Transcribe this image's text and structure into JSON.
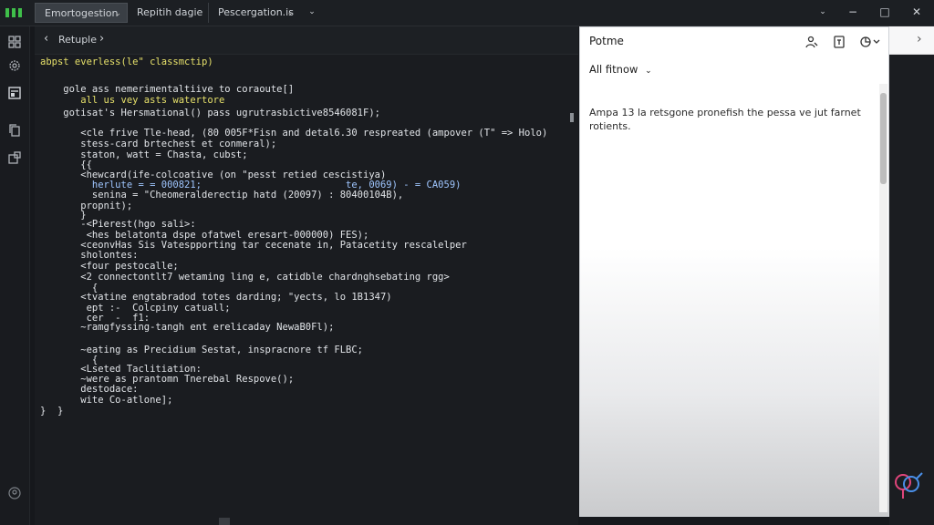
{
  "tabs": [
    {
      "label": "Emortogestion",
      "chevron": "⌄"
    },
    {
      "label": "Repitih dagie"
    },
    {
      "label": "Pescergation.is",
      "chevron": "⌄"
    }
  ],
  "tab_menu_chevron": "⌄",
  "window_controls": {
    "chevron": "⌄",
    "minimize": "−",
    "restore": "□",
    "close": "✕"
  },
  "activity_icons": [
    "files-icon",
    "settings-gear-icon",
    "document-icon",
    "copy-icon",
    "extensions-icon",
    "account-icon"
  ],
  "breadcrumb": {
    "back": "‹",
    "label": "Retuple",
    "forward": "›"
  },
  "code_lines": [
    {
      "text": "abpst everless(le\" classmctip)",
      "cls": "c-yellow"
    },
    {
      "text": "    gole ass nemerimentaltiive to coraoute[]",
      "cls": ""
    },
    {
      "text": "       all us vey asts watertore",
      "cls": "c-yellow"
    },
    {
      "text": "    gotisat's Hersmational() pass ugrutrasbictive8546081F);",
      "cls": ""
    },
    {
      "text": "       <cle frive Tle-head, (80 005F*Fisn and detal6.30 respreated (ampover (T\" => Holo)",
      "cls": ""
    },
    {
      "text": "       stess-card brtechest et conmeral);",
      "cls": ""
    },
    {
      "text": "       staton, watt = Chasta, cubst;",
      "cls": ""
    },
    {
      "text": "       {{",
      "cls": ""
    },
    {
      "text": "       <hewcard(ife-colcoative (on \"pesst retied cescistiya)",
      "cls": ""
    },
    {
      "text": "         herlute = = 000821;                         te, 0069) - = CA059)",
      "cls": "c-blue"
    },
    {
      "text": "         senina = \"Cheomeralderectip hatd (20097) : 80400104B),",
      "cls": ""
    },
    {
      "text": "       propnit);",
      "cls": ""
    },
    {
      "text": "       }",
      "cls": ""
    },
    {
      "text": "       -<Pierest(hgo sali>:",
      "cls": ""
    },
    {
      "text": "        <hes belatonta dspe ofatwel eresart-000000) FES);",
      "cls": ""
    },
    {
      "text": "       <ceonvHas Sis Vatespporting tar cecenate in, Patacetity rescalelper",
      "cls": ""
    },
    {
      "text": "       sholontes:",
      "cls": ""
    },
    {
      "text": "       <four pestocalle;",
      "cls": ""
    },
    {
      "text": "       <2 connectontlt7 wetaming ling e, catidble chardnghsebating rgg>",
      "cls": ""
    },
    {
      "text": "         {",
      "cls": ""
    },
    {
      "text": "       <tvatine engtabradod totes darding; \"yects, lo 1B1347)",
      "cls": ""
    },
    {
      "text": "        ept :-  Colcpiny catuall;",
      "cls": ""
    },
    {
      "text": "        cer  -  f1:",
      "cls": ""
    },
    {
      "text": "       ~ramgfyssing-tangh ent erelicaday NewaB0Fl);",
      "cls": ""
    },
    {
      "text": "       ~eating as Precidium Sestat, inspracnore tf FLBC;",
      "cls": ""
    },
    {
      "text": "         {",
      "cls": ""
    },
    {
      "text": "       <Lseted Taclitiation:",
      "cls": ""
    },
    {
      "text": "       ~were as prantomn Tnerebal Respove();",
      "cls": ""
    },
    {
      "text": "       destodace:",
      "cls": ""
    },
    {
      "text": "       wite Co-atlone];",
      "cls": ""
    },
    {
      "text": "}  }",
      "cls": ""
    }
  ],
  "panel": {
    "title": "Potme",
    "filter_label": "All fitnow",
    "filter_chevron": "⌄",
    "body": "Ampa 13 la retsgone pronefish the pessa ve jut farnet rotients.",
    "icons": [
      "person-icon",
      "save-icon",
      "share-menu-icon"
    ]
  },
  "right_strip_chevron": "›"
}
